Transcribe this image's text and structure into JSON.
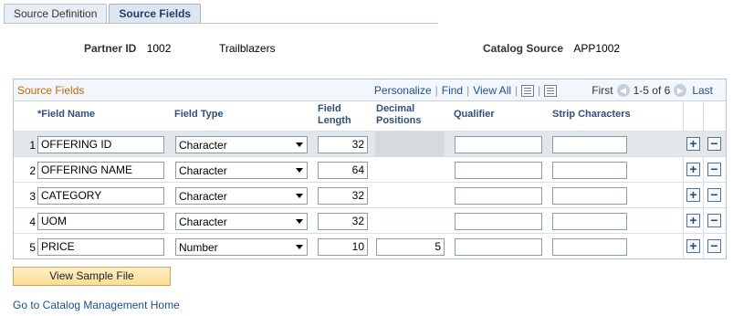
{
  "tabs": [
    {
      "label": "Source Definition",
      "active": false
    },
    {
      "label": "Source Fields",
      "active": true
    }
  ],
  "header": {
    "partner_id_label": "Partner ID",
    "partner_id": "1002",
    "partner_name": "Trailblazers",
    "catalog_source_label": "Catalog Source",
    "catalog_source": "APP1002"
  },
  "grid": {
    "title": "Source Fields",
    "personalize": "Personalize",
    "find": "Find",
    "view_all": "View All",
    "first": "First",
    "range": "1-5 of 6",
    "last": "Last",
    "columns": {
      "field_name": "*Field Name",
      "field_type": "Field Type",
      "field_length_1": "Field",
      "field_length_2": "Length",
      "decimal_1": "Decimal",
      "decimal_2": "Positions",
      "qualifier": "Qualifier",
      "strip": "Strip Characters"
    },
    "rows": [
      {
        "num": "1",
        "name": "OFFERING ID",
        "type": "Character",
        "length": "32",
        "decimal": "",
        "qualifier": "",
        "strip": ""
      },
      {
        "num": "2",
        "name": "OFFERING NAME",
        "type": "Character",
        "length": "64",
        "decimal": "",
        "qualifier": "",
        "strip": ""
      },
      {
        "num": "3",
        "name": "CATEGORY",
        "type": "Character",
        "length": "32",
        "decimal": "",
        "qualifier": "",
        "strip": ""
      },
      {
        "num": "4",
        "name": "UOM",
        "type": "Character",
        "length": "32",
        "decimal": "",
        "qualifier": "",
        "strip": ""
      },
      {
        "num": "5",
        "name": "PRICE",
        "type": "Number",
        "length": "10",
        "decimal": "5",
        "qualifier": "",
        "strip": ""
      }
    ],
    "add_symbol": "+",
    "remove_symbol": "−"
  },
  "view_sample_button": "View Sample File",
  "home_link": "Go to Catalog Management Home"
}
